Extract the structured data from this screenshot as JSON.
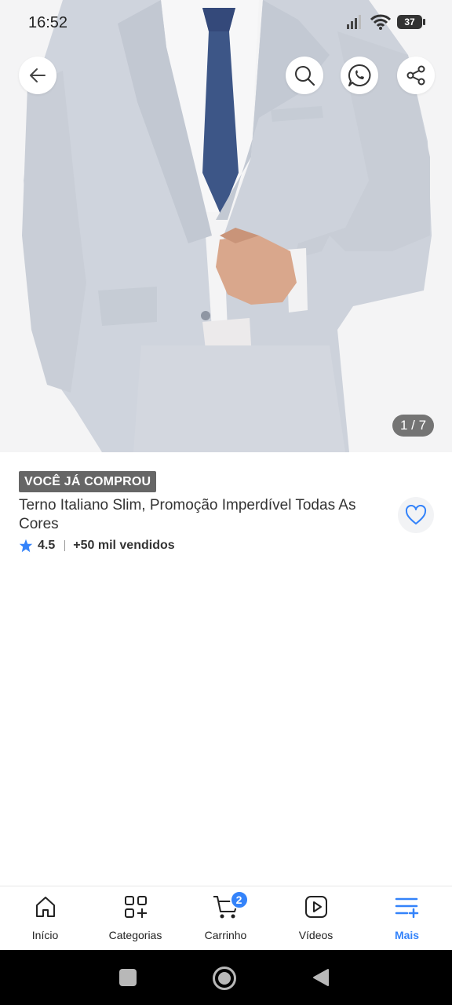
{
  "status_bar": {
    "time": "16:52",
    "battery": "37"
  },
  "gallery": {
    "counter": "1 / 7"
  },
  "product": {
    "badge": "VOCÊ JÁ COMPROU",
    "title": "Terno Italiano Slim, Promoção Imperdível Todas As Cores",
    "rating": "4.5",
    "sold": "+50 mil vendidos"
  },
  "bottom_nav": {
    "items": [
      {
        "label": "Início",
        "icon": "home-icon"
      },
      {
        "label": "Categorias",
        "icon": "categories-icon"
      },
      {
        "label": "Carrinho",
        "icon": "cart-icon",
        "badge": "2"
      },
      {
        "label": "Vídeos",
        "icon": "video-icon"
      },
      {
        "label": "Mais",
        "icon": "menu-plus-icon",
        "active": true
      }
    ]
  },
  "colors": {
    "accent": "#3483fa",
    "badge_bg": "#666666"
  }
}
